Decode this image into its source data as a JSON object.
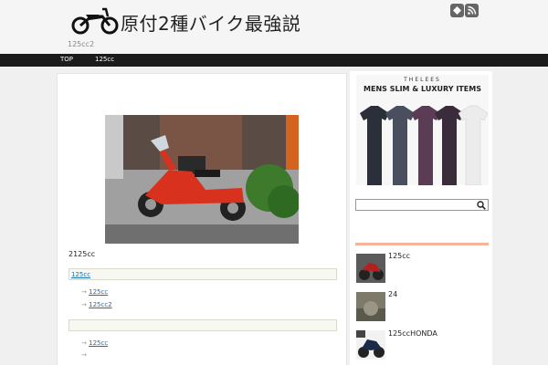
{
  "header": {
    "site_title": "原付2種バイク最強説",
    "tagline": "125cc2",
    "logo_icon": "scooter-icon",
    "sns": [
      {
        "name": "feedly-icon"
      },
      {
        "name": "rss-icon"
      }
    ]
  },
  "nav": {
    "items": [
      {
        "label": "TOP"
      },
      {
        "label": "125cc"
      }
    ]
  },
  "main": {
    "photo_icon": "red-scooter-photo",
    "caption": "2125cc",
    "toc": [
      {
        "heading": "125cc",
        "links": [
          "125cc",
          "125cc2"
        ]
      },
      {
        "heading": "",
        "links": [
          "125cc",
          ""
        ]
      }
    ]
  },
  "sidebar": {
    "ad": {
      "brand": "THELEES",
      "headline": "MENS SLIM & LUXURY ITEMS",
      "colors": [
        "#2b2f3a",
        "#4a4f60",
        "#5a3d55",
        "#3a2c3a",
        "#ececec"
      ]
    },
    "search": {
      "placeholder": ""
    },
    "accent_color": "#f3b49a",
    "posts": [
      {
        "title": "125cc"
      },
      {
        "title": "24"
      },
      {
        "title": "125ccHONDA"
      }
    ]
  }
}
